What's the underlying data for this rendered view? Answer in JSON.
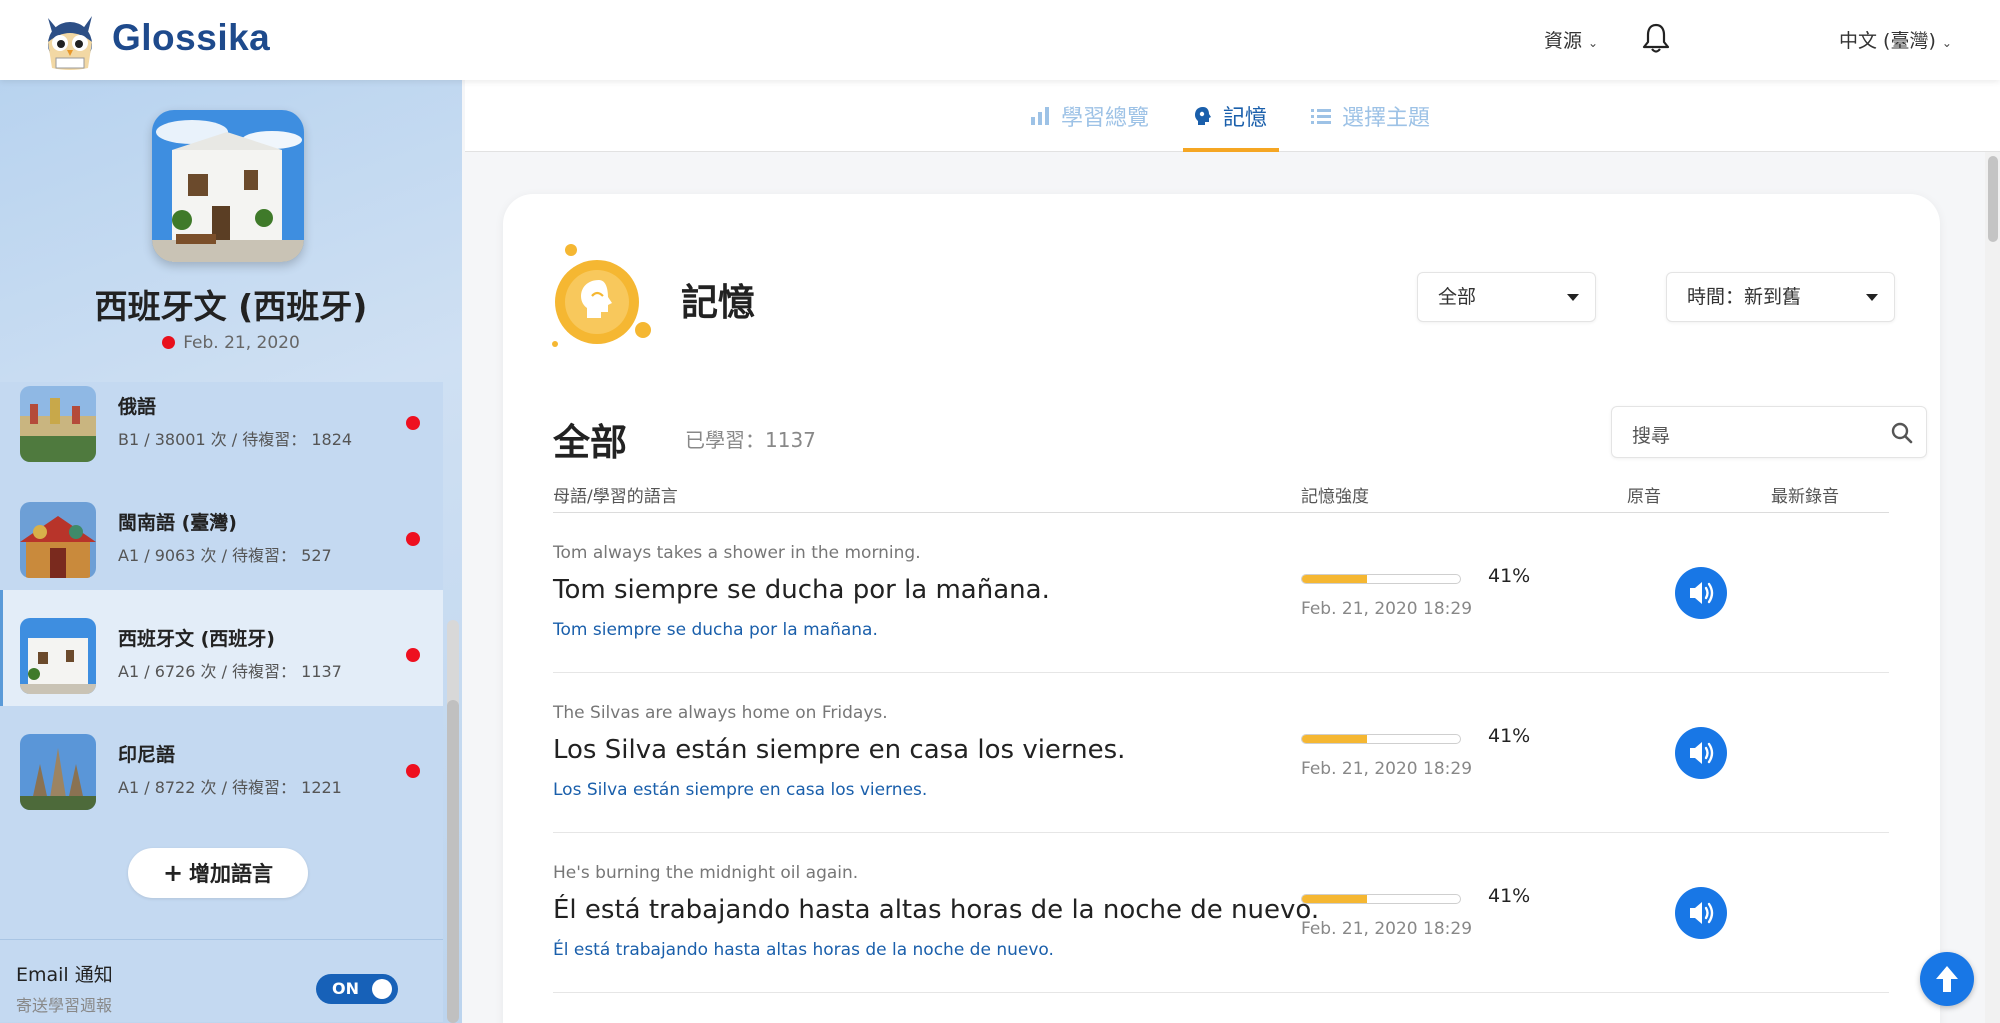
{
  "header": {
    "brand": "Glossika",
    "resources_label": "資源",
    "language_label": "中文 (臺灣)"
  },
  "sidebar": {
    "profile": {
      "name": "西班牙文 (西班牙)",
      "date": "Feb. 21, 2020"
    },
    "languages": [
      {
        "name": "俄語",
        "stats": "B1 / 38001 次 / 待複習： 1824"
      },
      {
        "name": "閩南語 (臺灣)",
        "stats": "A1 / 9063 次 / 待複習： 527"
      },
      {
        "name": "西班牙文 (西班牙)",
        "stats": "A1 / 6726 次 / 待複習： 1137"
      },
      {
        "name": "印尼語",
        "stats": "A1 / 8722 次 / 待複習： 1221"
      }
    ],
    "add_language": "增加語言",
    "email": {
      "title": "Email 通知",
      "subtitle": "寄送學習週報",
      "toggle": "ON"
    }
  },
  "tabs": [
    {
      "label": "學習總覽"
    },
    {
      "label": "記憶"
    },
    {
      "label": "選擇主題"
    }
  ],
  "memory": {
    "title": "記憶",
    "filter_all": "全部",
    "sort": "時間：新到舊",
    "section_title": "全部",
    "learned": "已學習：1137",
    "search_placeholder": "搜尋",
    "columns": {
      "language": "母語/學習的語言",
      "strength": "記憶強度",
      "original": "原音",
      "latest": "最新錄音"
    },
    "rows": [
      {
        "native": "Tom always takes a shower in the morning.",
        "target": "Tom siempre se ducha por la mañana.",
        "target_link": "Tom siempre se ducha por la mañana.",
        "strength": 41,
        "strength_label": "41%",
        "date": "Feb. 21, 2020 18:29"
      },
      {
        "native": "The Silvas are always home on Fridays.",
        "target": "Los Silva están siempre en casa los viernes.",
        "target_link": "Los Silva están siempre en casa los viernes.",
        "strength": 41,
        "strength_label": "41%",
        "date": "Feb. 21, 2020 18:29"
      },
      {
        "native": "He's burning the midnight oil again.",
        "target": "Él está trabajando hasta altas horas de la noche de nuevo.",
        "target_link": "Él está trabajando hasta altas horas de la noche de nuevo.",
        "strength": 41,
        "strength_label": "41%",
        "date": "Feb. 21, 2020 18:29"
      }
    ]
  },
  "colors": {
    "brand": "#1e4a8c",
    "accent": "#1877e6",
    "highlight": "#f5a623",
    "status_dot": "#e8101c"
  },
  "icons": [
    "owl-logo-icon",
    "bell-icon",
    "bar-chart-icon",
    "brain-icon",
    "list-icon",
    "search-icon",
    "speaker-icon",
    "arrow-up-icon",
    "plus-icon"
  ]
}
